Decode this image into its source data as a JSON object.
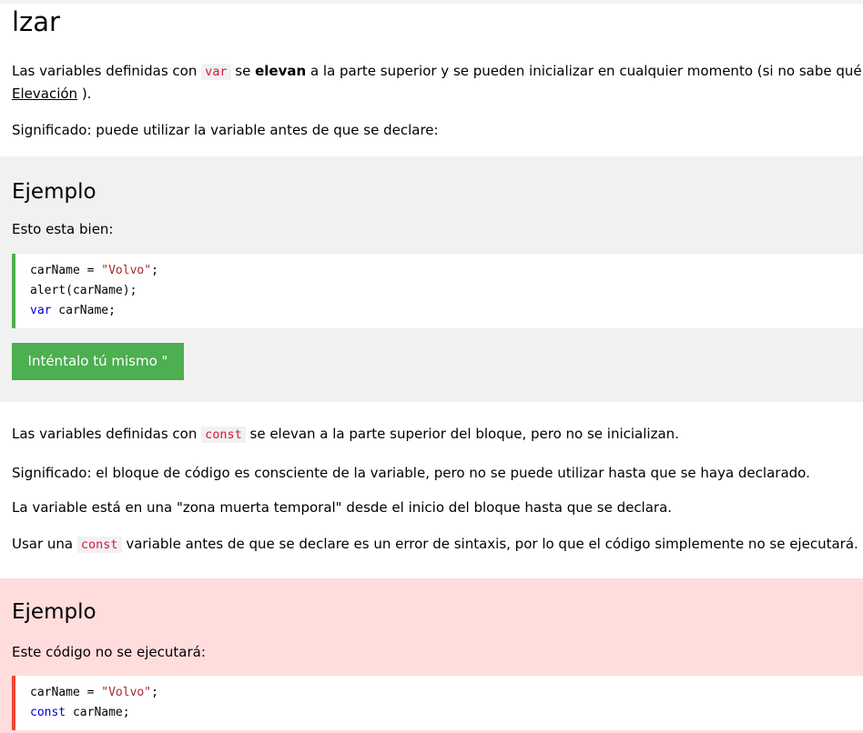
{
  "page": {
    "title": "lzar"
  },
  "intro": {
    "p1_before": "Las variables definidas con ",
    "p1_code": "var",
    "p1_mid": " se ",
    "p1_strong": "elevan",
    "p1_after": " a la parte superior y se pueden inicializar en cualquier momento (si no sabe qué es",
    "p1_link": "Elevación",
    "p1_end": " ).",
    "p2": "Significado: puede utilizar la variable antes de que se declare:"
  },
  "example1": {
    "title": "Ejemplo",
    "desc": "Esto esta bien:",
    "code": {
      "line1_plain": "carName = ",
      "line1_str": "\"Volvo\"",
      "line1_end": ";",
      "line2": "alert(carName);",
      "line3_kw": "var",
      "line3_rest": " carName;"
    },
    "button_label": "Inténtalo tú mismo \""
  },
  "middle": {
    "p1_before": "Las variables definidas con ",
    "p1_code": "const",
    "p1_after": " se elevan a la parte superior del bloque, pero no se inicializan.",
    "p2": "Significado: el bloque de código es consciente de la variable, pero no se puede utilizar hasta que se haya declarado.",
    "p3": "La variable está en una \"zona muerta temporal\" desde el inicio del bloque hasta que se declara.",
    "p4_before": "Usar una ",
    "p4_code": "const",
    "p4_after": " variable antes de que se declare es un error de sintaxis, por lo que el código simplemente no se ejecutará."
  },
  "example2": {
    "title": "Ejemplo",
    "desc": "Este código no se ejecutará:",
    "code": {
      "line1_plain": "carName = ",
      "line1_str": "\"Volvo\"",
      "line1_end": ";",
      "line2_kw": "const",
      "line2_rest": " carName;"
    }
  },
  "colors": {
    "accent_green": "#4caf50",
    "accent_red": "#f44336",
    "example_gray_bg": "#f1f1f1",
    "example_red_bg": "#ffdddd",
    "inline_code": "#dc143c"
  }
}
